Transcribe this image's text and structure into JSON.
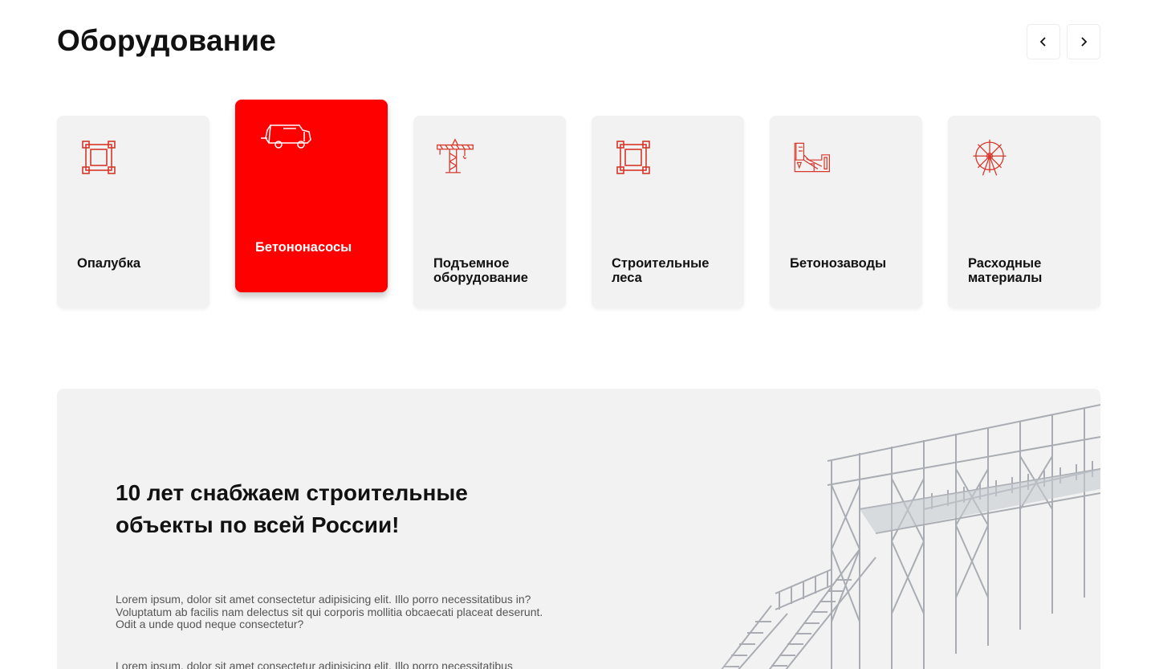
{
  "section": {
    "title": "Оборудование"
  },
  "nav": {
    "prev_icon": "chevron-left-icon",
    "next_icon": "chevron-right-icon"
  },
  "categories": [
    {
      "label": "Опалубка",
      "icon": "formwork-frame-icon",
      "active": false
    },
    {
      "label": "Бетононасосы",
      "icon": "concrete-pump-truck-icon",
      "active": true
    },
    {
      "label": "Подъемное оборудование",
      "icon": "tower-crane-icon",
      "active": false
    },
    {
      "label": "Строительные леса",
      "icon": "scaffolding-frame-icon",
      "active": false
    },
    {
      "label": "Бетонозаводы",
      "icon": "concrete-plant-icon",
      "active": false
    },
    {
      "label": "Расходные материалы",
      "icon": "cutting-disc-icon",
      "active": false
    }
  ],
  "banner": {
    "title": "10 лет снабжаем строительные объекты по всей России!",
    "paragraphs": [
      "Lorem ipsum, dolor sit amet consectetur adipisicing elit. Illo porro necessitatibus in? Voluptatum ab facilis nam delectus sit qui corporis mollitia obcaecati placeat deserunt. Odit a unde quod neque consectetur?",
      "Lorem ipsum, dolor sit amet consectetur adipisicing elit. Illo porro necessitatibus"
    ],
    "image": "scaffolding-bridge-image"
  },
  "colors": {
    "accent": "#ff0000",
    "icon_stroke": "#d8372a",
    "card_bg": "#f2f2f2",
    "text": "#111111",
    "muted_text": "#555555"
  }
}
